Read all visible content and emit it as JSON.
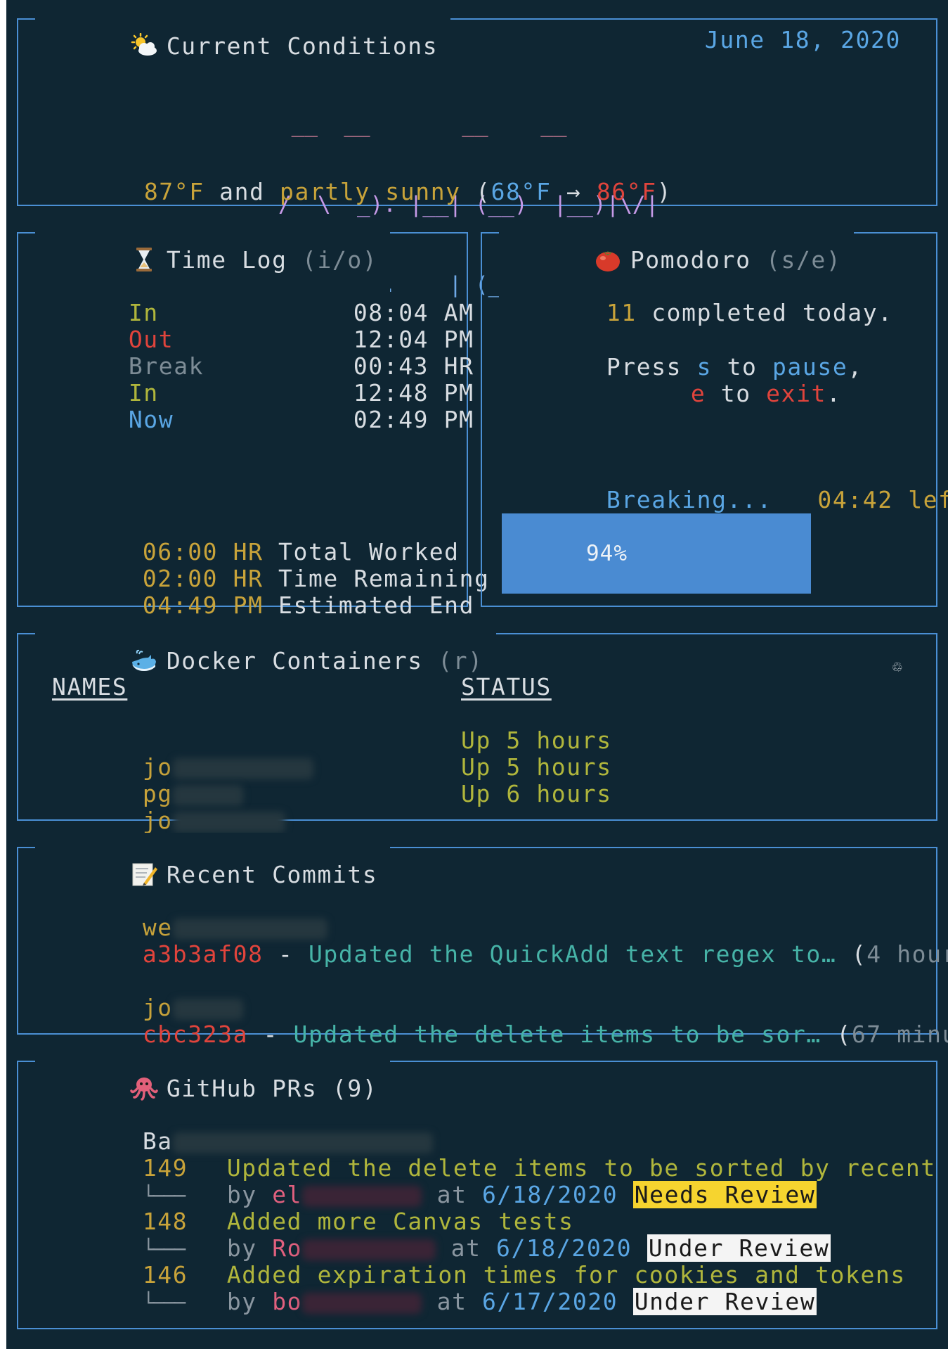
{
  "colors": {
    "background": "#0f2633",
    "border": "#4a8fd4",
    "yellow": "#c8a33a",
    "green": "#b0b63c",
    "red": "#e0443c",
    "blue": "#5aa6e4",
    "teal": "#46b3a7",
    "gray": "#7d8c96",
    "text": "#d8dde2",
    "progress": "#4a8bd2"
  },
  "conditions": {
    "title": "Current Conditions",
    "icon": "sun-behind-cloud-icon",
    "date": "June 18, 2020",
    "clock_line1": " __  __       __    __",
    "clock_line2": "/  \\  _). |__| (__)  |__)|\\/|",
    "clock_line3": "\\__/ /__.    | (__)  |   |  |",
    "temp": "87°F",
    "and": "and",
    "desc": "partly sunny",
    "open_paren": "(",
    "low": "68°F",
    "arrow": "→",
    "high": "86°F",
    "close_paren": ")"
  },
  "timelog": {
    "title": "Time Log",
    "hint": "(i/o)",
    "icon": "hourglass-icon",
    "entries": [
      {
        "label": "In",
        "time": "08:04 AM"
      },
      {
        "label": "Out",
        "time": "12:04 PM"
      },
      {
        "label": "Break",
        "time": "00:43 HR"
      },
      {
        "label": "In",
        "time": "12:48 PM"
      },
      {
        "label": "Now",
        "time": "02:49 PM"
      }
    ],
    "summary": [
      {
        "value": "06:00",
        "unit": "HR",
        "label": "Total Worked"
      },
      {
        "value": "02:00",
        "unit": "HR",
        "label": "Time Remaining"
      },
      {
        "value": "04:49",
        "unit": "PM",
        "label": "Estimated End"
      }
    ]
  },
  "pomodoro": {
    "title": "Pomodoro",
    "hint": "(s/e)",
    "icon": "tomato-icon",
    "completed_count": "11",
    "completed_text": "completed today.",
    "press": "Press",
    "key_s": "s",
    "to1": "to",
    "pause": "pause",
    "comma": ",",
    "key_e": "e",
    "to2": "to",
    "exit": "exit",
    "period": ".",
    "status": "Breaking...",
    "time_left": "04:42",
    "left": "left",
    "progress_label": "94%",
    "progress_fraction": 1.0
  },
  "docker": {
    "title": "Docker Containers",
    "hint": "(r)",
    "icon": "whale-icon",
    "corner_icon": "recycle-icon",
    "col_names": "NAMES",
    "col_status": "STATUS",
    "rows": [
      {
        "name": "jo",
        "status": "Up 5 hours"
      },
      {
        "name": "pg",
        "status": "Up 5 hours"
      },
      {
        "name": "jo",
        "status": "Up 6 hours"
      }
    ]
  },
  "commits": {
    "title": "Recent Commits",
    "icon": "memo-icon",
    "items": [
      {
        "repo": "we",
        "hash": "a3b3af08",
        "dash": "-",
        "message": "Updated the QuickAdd text regex to…",
        "open": "(",
        "age_num": "4",
        "age_text": "hours ago",
        "close": ")"
      },
      {
        "repo": "jo",
        "hash": "cbc323a",
        "dash": "-",
        "message": "Updated the delete items to be sor…",
        "open": "(",
        "age_num": "67",
        "age_text": "minutes ago",
        "close": ")"
      }
    ]
  },
  "github": {
    "title": "GitHub PRs",
    "count": "(9)",
    "icon": "octopus-icon",
    "repo": "Ba",
    "branch_glyph": "└───",
    "prs": [
      {
        "number": "149",
        "title": "Updated the delete items to be sorted by recent on top",
        "by": "by",
        "author": "el",
        "at": "at",
        "date": "6/18/2020",
        "status": "Needs Review"
      },
      {
        "number": "148",
        "title": "Added more Canvas tests",
        "by": "by",
        "author": "Ro",
        "at": "at",
        "date": "6/18/2020",
        "status": "Under Review"
      },
      {
        "number": "146",
        "title": "Added expiration times for cookies and tokens",
        "by": "by",
        "author": "bo",
        "at": "at",
        "date": "6/17/2020",
        "status": "Under Review"
      }
    ]
  }
}
